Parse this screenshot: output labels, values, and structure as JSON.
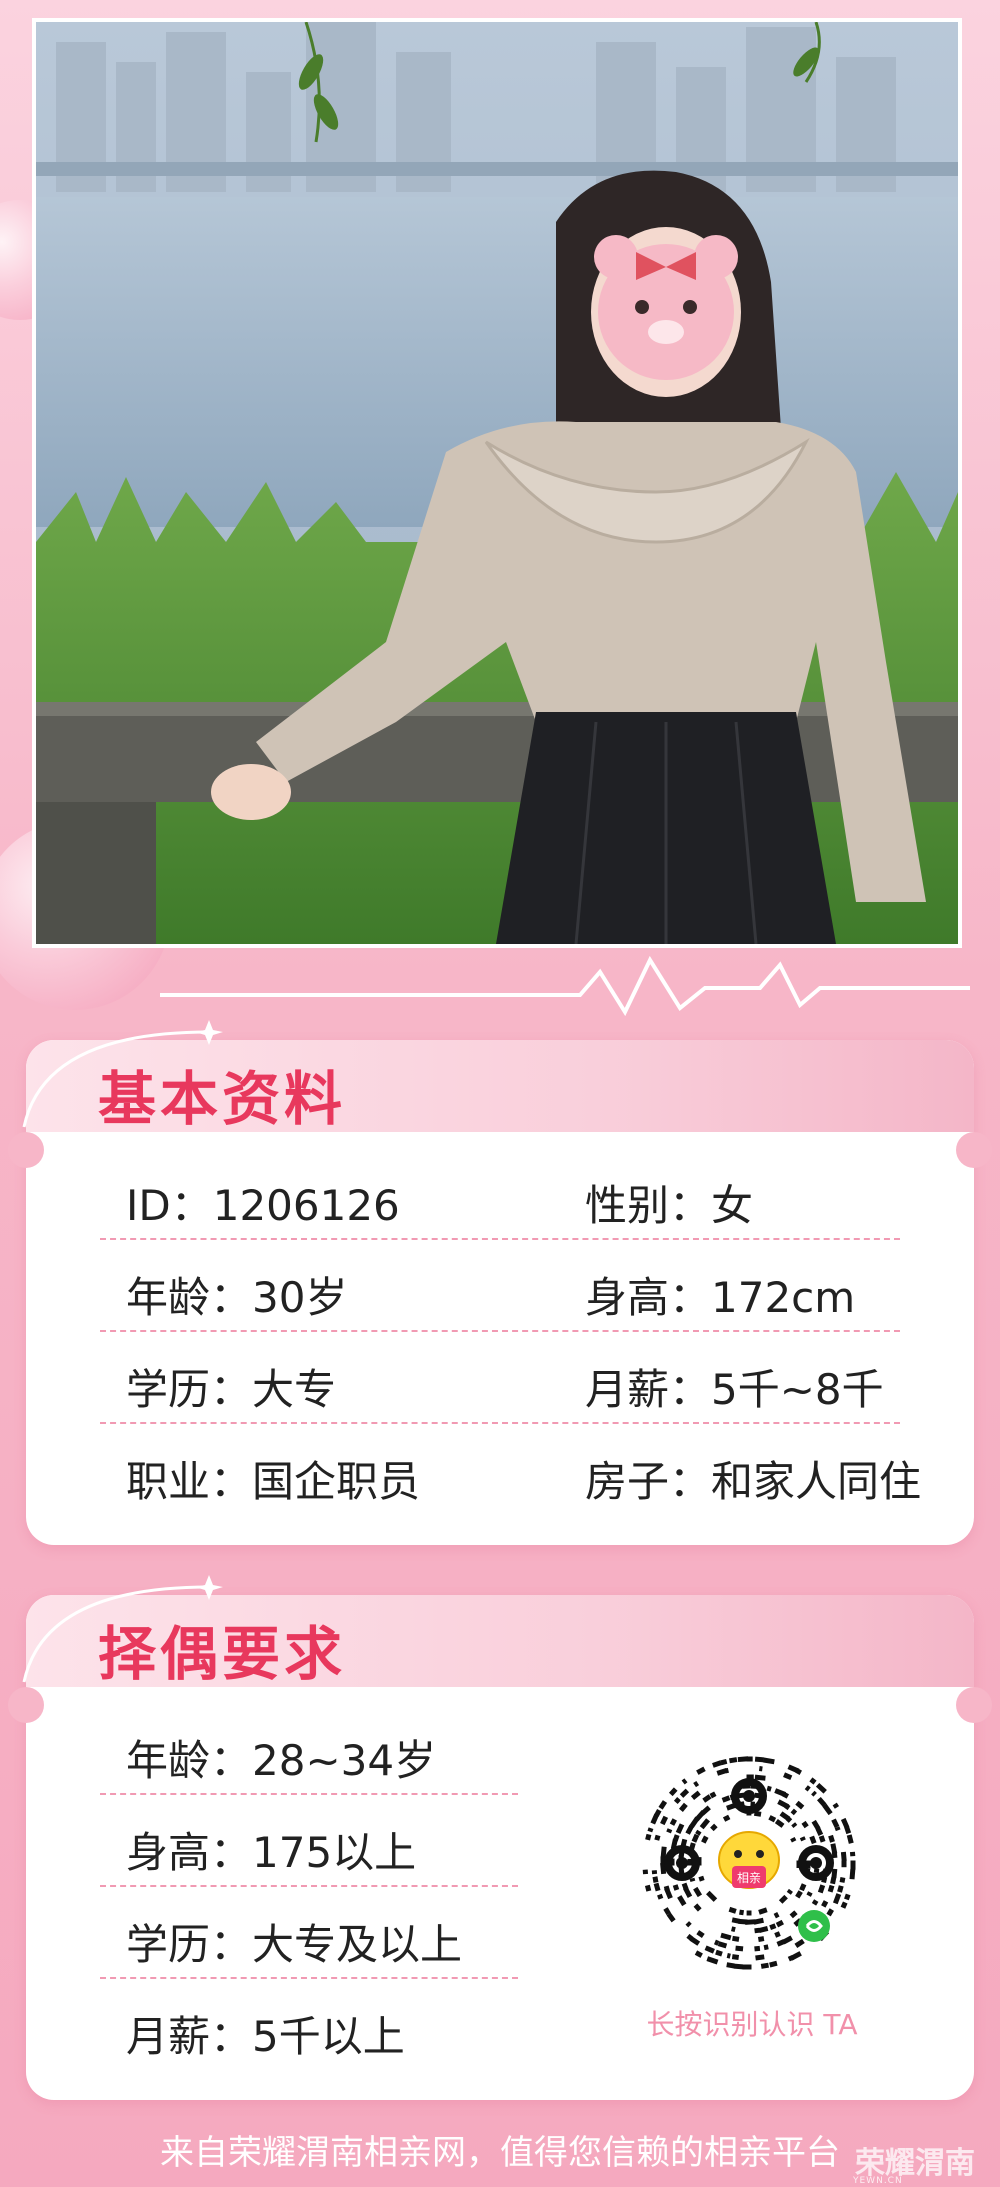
{
  "basic": {
    "title": "基本资料",
    "rows": [
      {
        "left": "ID：1206126",
        "right": "性别：女"
      },
      {
        "left": "年龄：30岁",
        "right": "身高：172cm"
      },
      {
        "left": "学历：大专",
        "right": "月薪：5千~8千"
      },
      {
        "left": "职业：国企职员",
        "right": "房子：和家人同住"
      }
    ]
  },
  "requirements": {
    "title": "择偶要求",
    "rows": [
      "年龄：28~34岁",
      "身高：175以上",
      "学历：大专及以上",
      "月薪：5千以上"
    ]
  },
  "qr": {
    "caption": "长按识别认识 TA",
    "center_text": "相亲"
  },
  "footer": {
    "text": "来自荣耀渭南相亲网，值得您信赖的相亲平台"
  },
  "watermark": {
    "name": "荣耀渭南",
    "sub": "YEWN.CN"
  },
  "colors": {
    "accent": "#e8385d",
    "pink_bg": "#f7b6c8",
    "divider": "#f19ab3"
  }
}
